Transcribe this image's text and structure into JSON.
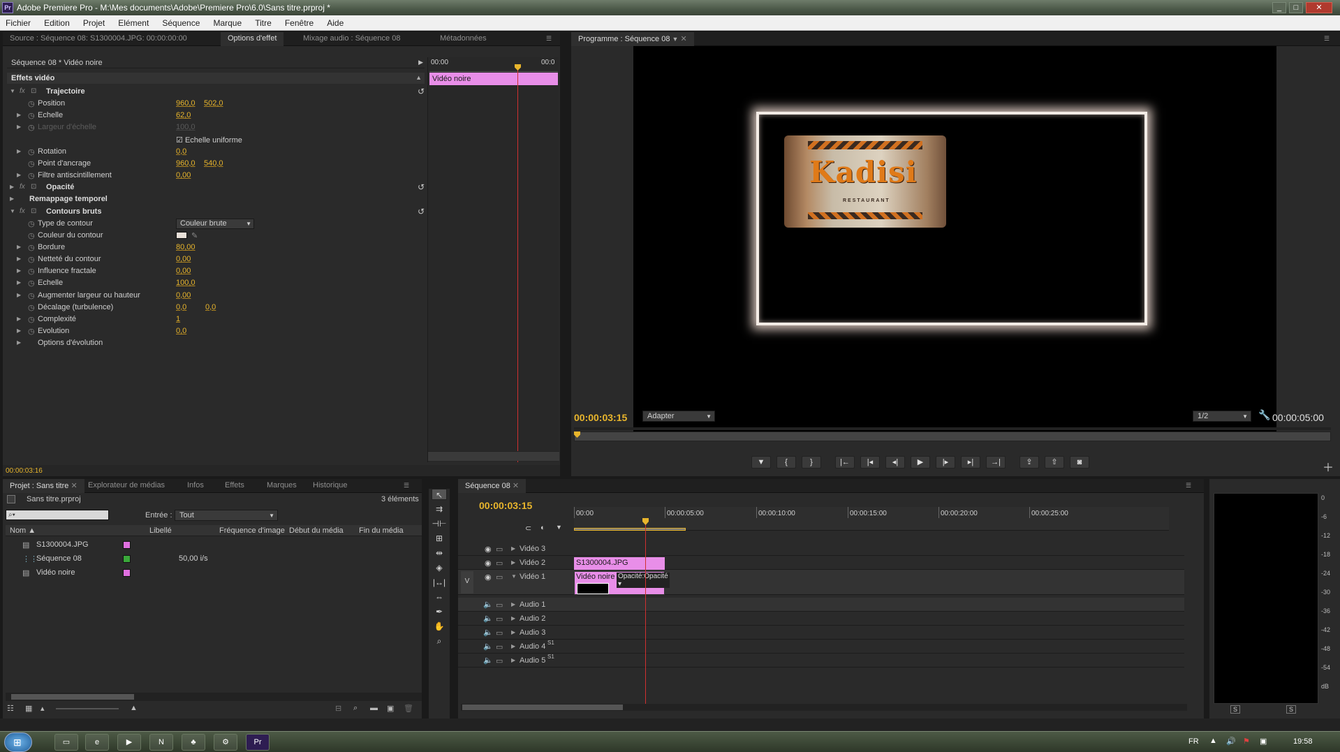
{
  "window": {
    "title": "Adobe Premiere Pro - M:\\Mes documents\\Adobe\\Premiere Pro\\6.0\\Sans titre.prproj *",
    "app_badge": "Pr"
  },
  "menu": [
    "Fichier",
    "Edition",
    "Projet",
    "Elément",
    "Séquence",
    "Marque",
    "Titre",
    "Fenêtre",
    "Aide"
  ],
  "source_panel": {
    "tabs": [
      "Source : Séquence 08: S1300004.JPG: 00:00:00:00",
      "Options d'effet",
      "Mixage audio : Séquence 08",
      "Métadonnées"
    ],
    "active_tab": 1,
    "clip_header": "Séquence 08 * Vidéo noire",
    "section": "Effets vidéo",
    "tl_start": "00:00",
    "tl_end": "00:0",
    "clip_bar_label": "Vidéo noire",
    "timecode": "00:00:03:16",
    "effects": [
      {
        "indent": 0,
        "twirl": "open",
        "fx": true,
        "name": "Trajectoire",
        "bold": true,
        "reset": true
      },
      {
        "indent": 1,
        "twirl": "",
        "sw": true,
        "name": "Position",
        "v1": "960,0",
        "v2": "502,0"
      },
      {
        "indent": 1,
        "twirl": "closed",
        "sw": true,
        "name": "Echelle",
        "v1": "62,0"
      },
      {
        "indent": 1,
        "twirl": "closed",
        "sw": true,
        "name": "Largeur d'échelle",
        "v1": "100,0",
        "dim": true
      },
      {
        "indent": 1,
        "twirl": "",
        "name": "",
        "checkbox": "Echelle uniforme"
      },
      {
        "indent": 1,
        "twirl": "closed",
        "sw": true,
        "name": "Rotation",
        "v1": "0,0"
      },
      {
        "indent": 1,
        "twirl": "",
        "sw": true,
        "name": "Point d'ancrage",
        "v1": "960,0",
        "v2": "540,0"
      },
      {
        "indent": 1,
        "twirl": "closed",
        "sw": true,
        "name": "Filtre antiscintillement",
        "v1": "0,00"
      },
      {
        "indent": 0,
        "twirl": "closed",
        "fx": true,
        "name": "Opacité",
        "bold": true,
        "reset": true
      },
      {
        "indent": 0,
        "twirl": "closed",
        "fx": false,
        "name": "Remappage temporel",
        "bold": true
      },
      {
        "indent": 0,
        "twirl": "open",
        "fx": true,
        "name": "Contours bruts",
        "bold": true,
        "reset": true
      },
      {
        "indent": 1,
        "twirl": "",
        "sw": true,
        "name": "Type de contour",
        "dropdown": "Couleur brute"
      },
      {
        "indent": 1,
        "twirl": "",
        "sw": true,
        "name": "Couleur du contour",
        "color": "#e8e0d8"
      },
      {
        "indent": 1,
        "twirl": "closed",
        "sw": true,
        "name": "Bordure",
        "v1": "80,00"
      },
      {
        "indent": 1,
        "twirl": "closed",
        "sw": true,
        "name": "Netteté du contour",
        "v1": "0,00"
      },
      {
        "indent": 1,
        "twirl": "closed",
        "sw": true,
        "name": "Influence fractale",
        "v1": "0,00"
      },
      {
        "indent": 1,
        "twirl": "closed",
        "sw": true,
        "name": "Echelle",
        "v1": "100,0"
      },
      {
        "indent": 1,
        "twirl": "closed",
        "sw": true,
        "name": "Augmenter largeur ou hauteur",
        "v1": "0,00"
      },
      {
        "indent": 1,
        "twirl": "",
        "sw": true,
        "name": "Décalage (turbulence)",
        "v1": "0,0",
        "v2": "0,0"
      },
      {
        "indent": 1,
        "twirl": "closed",
        "sw": true,
        "name": "Complexité",
        "v1": "1"
      },
      {
        "indent": 1,
        "twirl": "closed",
        "sw": true,
        "name": "Evolution",
        "v1": "0,0"
      },
      {
        "indent": 1,
        "twirl": "closed",
        "sw": false,
        "name": "Options d'évolution"
      }
    ]
  },
  "program": {
    "tab": "Programme : Séquence 08",
    "timecode_left": "00:00:03:15",
    "fit": "Adapter",
    "resolution": "1/2",
    "timecode_right": "00:00:05:00",
    "logo_text": "Kadisi",
    "logo_sub": "RESTAURANT",
    "controls": [
      "marker-icon",
      "in-point-icon",
      "out-point-icon",
      "go-to-in-icon",
      "step-back-icon",
      "step-frame-back-icon",
      "play-icon",
      "step-frame-forward-icon",
      "step-forward-icon",
      "go-to-out-icon",
      "lift-icon",
      "extract-icon",
      "export-frame-icon"
    ],
    "control_glyphs": [
      "▼",
      "{",
      "}",
      "|←",
      "|◂",
      "◂|",
      "▶",
      "|▸",
      "▸|",
      "→|",
      "⇪",
      "⇧",
      "◙"
    ]
  },
  "project": {
    "tabs": [
      "Projet : Sans titre",
      "Explorateur de médias",
      "Infos",
      "Effets",
      "Marques",
      "Historique"
    ],
    "file": "Sans titre.prproj",
    "count": "3 éléments",
    "entry_label": "Entrée :",
    "entry_value": "Tout",
    "columns": [
      "Nom",
      "Libellé",
      "Fréquence d'image",
      "Début du média",
      "Fin du média"
    ],
    "items": [
      {
        "name": "S1300004.JPG",
        "color": "#e070e0",
        "fps": ""
      },
      {
        "name": "Séquence 08",
        "color": "#3aa83a",
        "fps": "50,00 i/s"
      },
      {
        "name": "Vidéo noire",
        "color": "#e070e0",
        "fps": ""
      }
    ]
  },
  "sequence": {
    "tab": "Séquence 08",
    "timecode": "00:00:03:15",
    "ruler": [
      "00:00",
      "00:00:05:00",
      "00:00:10:00",
      "00:00:15:00",
      "00:00:20:00",
      "00:00:25:00"
    ],
    "video_tracks": [
      "Vidéo 3",
      "Vidéo 2",
      "Vidéo 1"
    ],
    "audio_tracks": [
      "Audio 1",
      "Audio 2",
      "Audio 3",
      "Audio 4",
      "Audio 5"
    ],
    "clip_v2": "S1300004.JPG",
    "clip_v1": "Vidéo noire",
    "clip_v1_fx": "Opacité:Opacité ▾",
    "v_label": "V",
    "s1": "S1"
  },
  "meter": {
    "scale": [
      "0",
      "-6",
      "-12",
      "-18",
      "-24",
      "-30",
      "-36",
      "-42",
      "-48",
      "-54",
      "dB"
    ],
    "solo": "S"
  },
  "taskbar": {
    "lang": "FR",
    "time": "19:58",
    "premiere": "Pr"
  },
  "colors": {
    "accent": "#e8b52c",
    "clip_pink": "#e88ee8",
    "playhead": "#d03030"
  }
}
